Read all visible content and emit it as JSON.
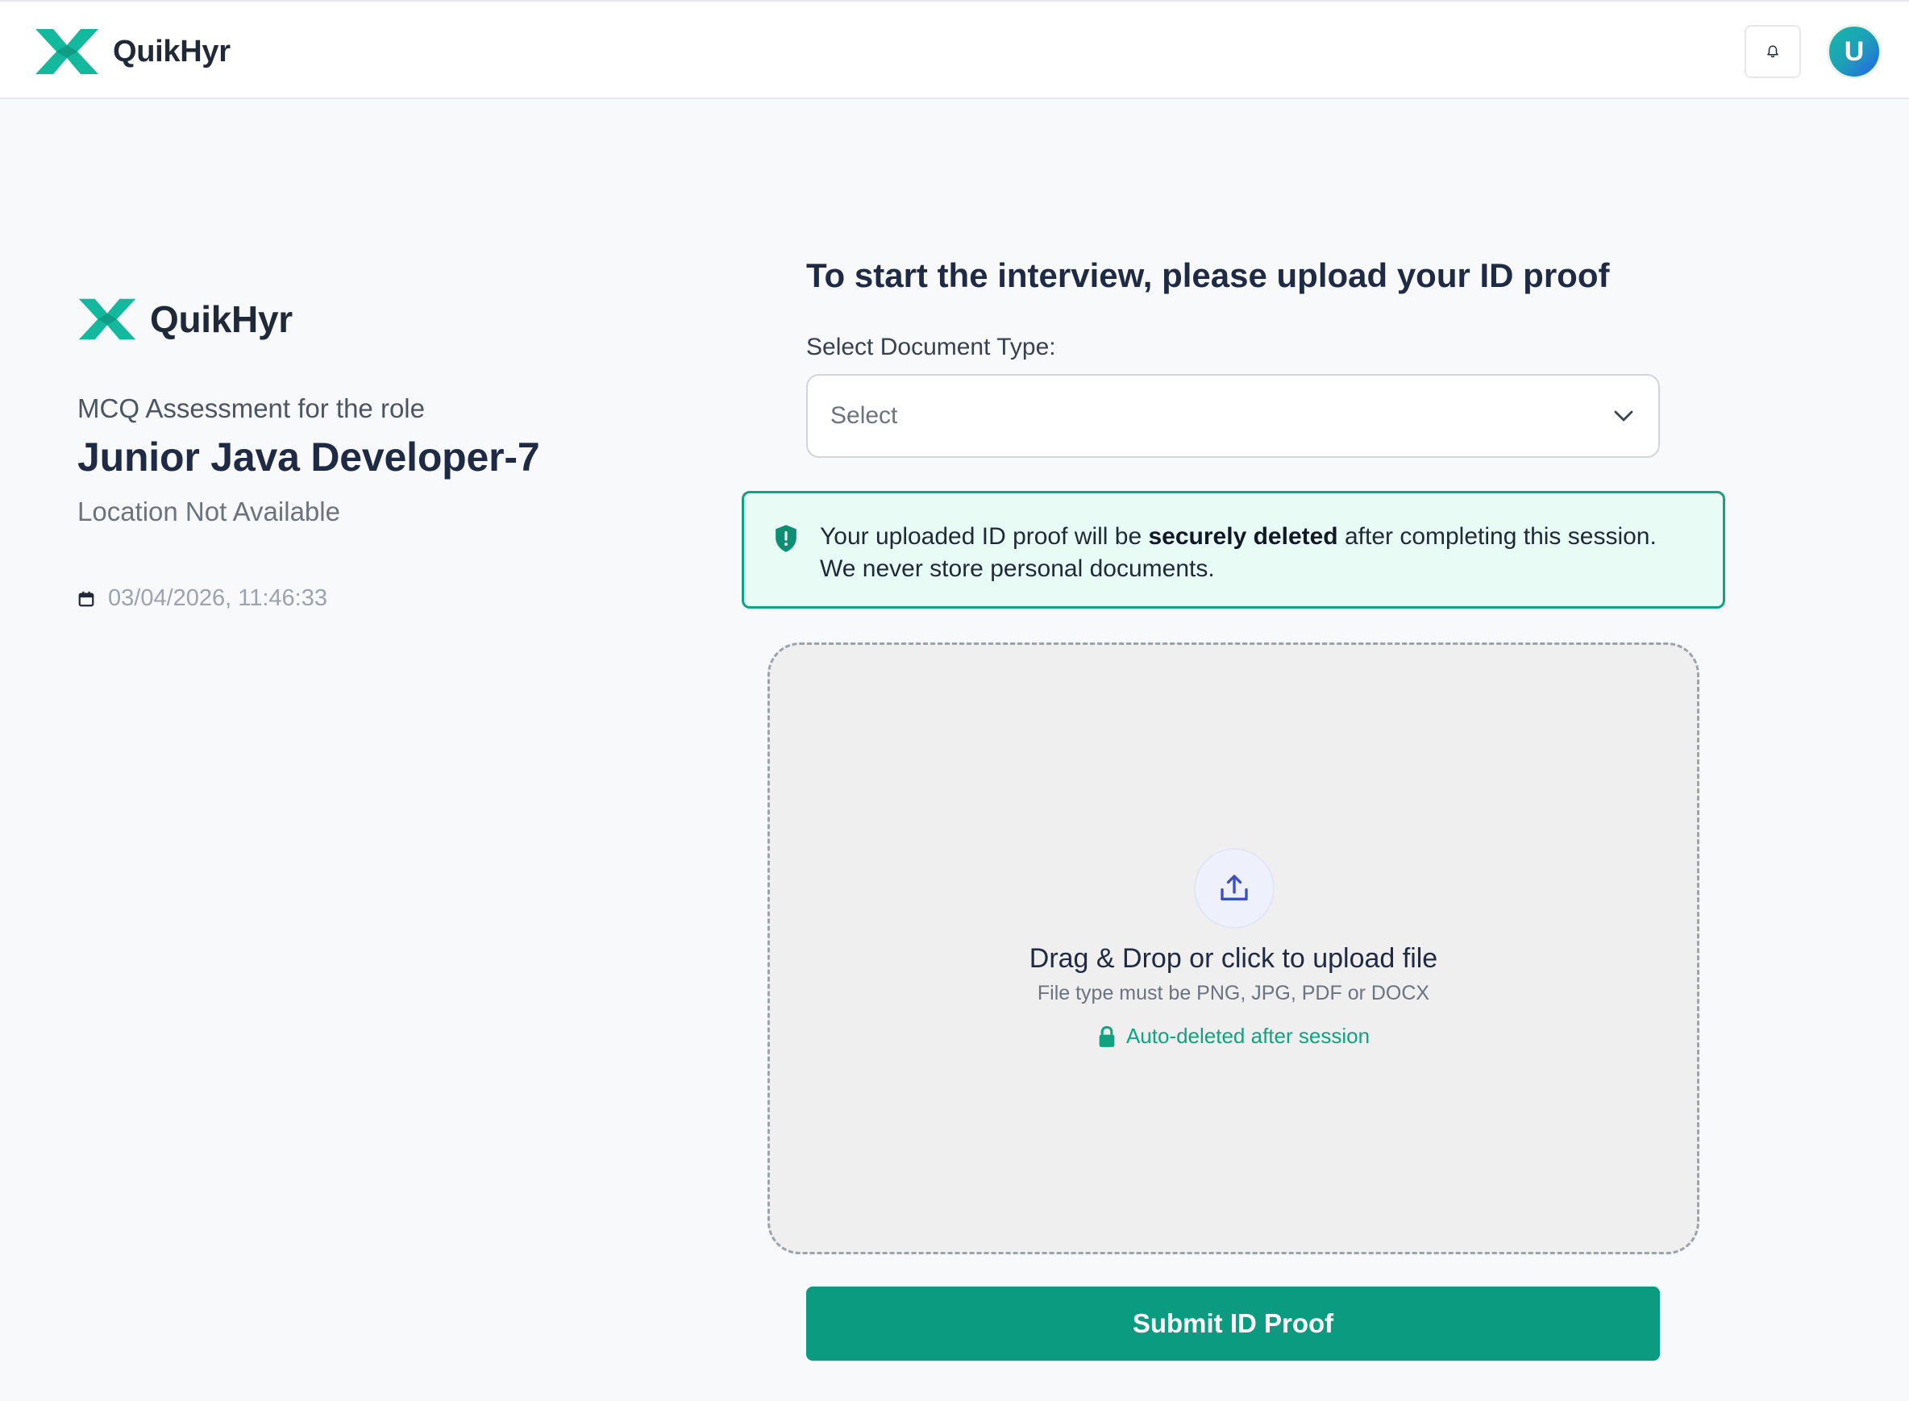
{
  "header": {
    "brand_name": "QuikHyr",
    "logo_icon": "quikhyr-logo-icon",
    "bell_icon": "bell-icon",
    "avatar_initial": "U"
  },
  "assessment": {
    "brand_name": "QuikHyr",
    "role_label": "MCQ Assessment for the role",
    "job_title": "Junior Java Developer-7",
    "location": "Location Not Available",
    "datetime": "03/04/2026, 11:46:33",
    "calendar_icon": "calendar-icon"
  },
  "upload": {
    "title": "To start the interview, please upload your ID proof",
    "doc_type_label": "Select Document Type:",
    "doc_type_selected": "Select",
    "notice": {
      "pre": "Your uploaded ID proof will be ",
      "bold": "securely deleted",
      "post": " after completing this session. We never store personal documents.",
      "icon": "shield-icon"
    },
    "dropzone": {
      "icon": "upload-icon",
      "title": "Drag & Drop or click to upload file",
      "subtitle": "File type must be PNG, JPG, PDF or DOCX",
      "auto_delete": "Auto-deleted after session",
      "lock_icon": "lock-icon"
    },
    "submit_label": "Submit ID Proof"
  },
  "colors": {
    "brand_teal": "#10b39a",
    "accent_green": "#10a37f",
    "button_green": "#0b9b80",
    "notice_bg": "#e8fbf4",
    "upload_icon_blue": "#3b4fc4"
  }
}
